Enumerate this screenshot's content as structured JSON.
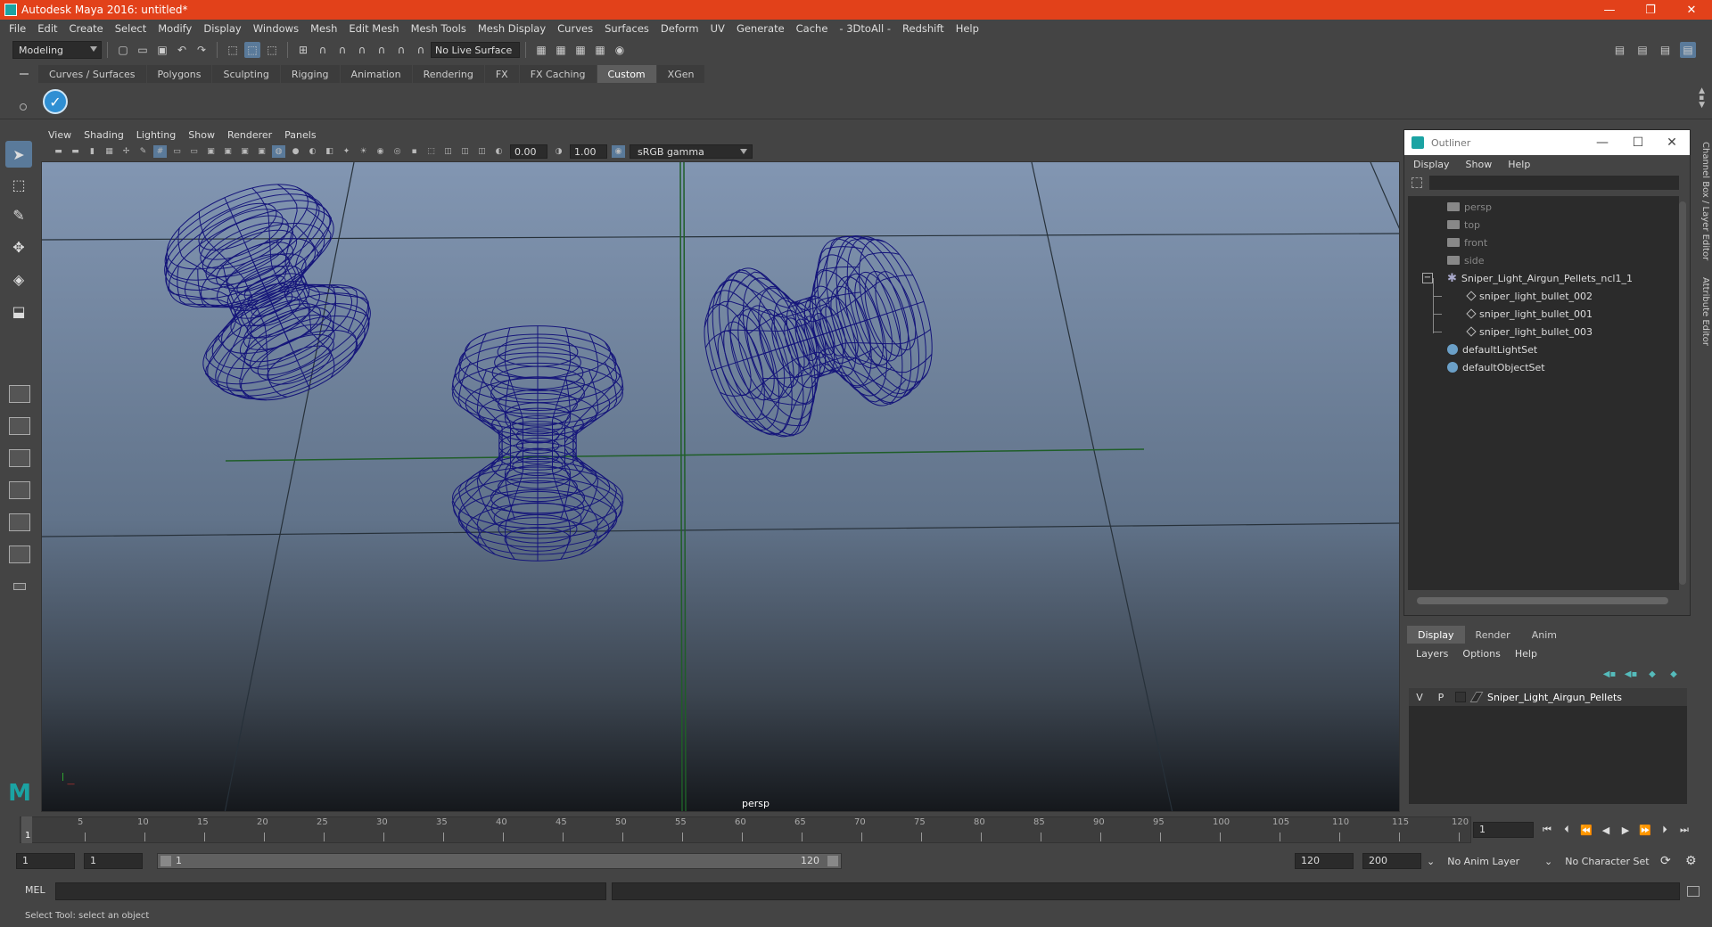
{
  "window": {
    "title": "Autodesk Maya 2016: untitled*"
  },
  "menubar": [
    "File",
    "Edit",
    "Create",
    "Select",
    "Modify",
    "Display",
    "Windows",
    "Mesh",
    "Edit Mesh",
    "Mesh Tools",
    "Mesh Display",
    "Curves",
    "Surfaces",
    "Deform",
    "UV",
    "Generate",
    "Cache",
    "- 3DtoAll -",
    "Redshift",
    "Help"
  ],
  "statusline": {
    "mode": "Modeling",
    "live_surface": "No Live Surface"
  },
  "shelf": {
    "tabs": [
      "Curves / Surfaces",
      "Polygons",
      "Sculpting",
      "Rigging",
      "Animation",
      "Rendering",
      "FX",
      "FX Caching",
      "Custom",
      "XGen"
    ],
    "active_tab": "Custom"
  },
  "viewport": {
    "menu": [
      "View",
      "Shading",
      "Lighting",
      "Show",
      "Renderer",
      "Panels"
    ],
    "exposure": "0.00",
    "gamma": "1.00",
    "color_space": "sRGB gamma",
    "camera_label": "persp",
    "wire_color": "#15157a"
  },
  "outliner": {
    "title": "Outliner",
    "menu": [
      "Display",
      "Show",
      "Help"
    ],
    "items": [
      {
        "label": "persp",
        "type": "camera",
        "dim": true
      },
      {
        "label": "top",
        "type": "camera",
        "dim": true
      },
      {
        "label": "front",
        "type": "camera",
        "dim": true
      },
      {
        "label": "side",
        "type": "camera",
        "dim": true
      },
      {
        "label": "Sniper_Light_Airgun_Pellets_ncl1_1",
        "type": "group",
        "dim": false
      },
      {
        "label": "sniper_light_bullet_002",
        "type": "mesh",
        "dim": false
      },
      {
        "label": "sniper_light_bullet_001",
        "type": "mesh",
        "dim": false
      },
      {
        "label": "sniper_light_bullet_003",
        "type": "mesh",
        "dim": false
      },
      {
        "label": "defaultLightSet",
        "type": "set",
        "dim": false
      },
      {
        "label": "defaultObjectSet",
        "type": "set",
        "dim": false
      }
    ]
  },
  "edge_tabs": [
    "Channel Box / Layer Editor",
    "Attribute Editor"
  ],
  "layer_editor": {
    "tabs": [
      "Display",
      "Render",
      "Anim"
    ],
    "active_tab": "Display",
    "menu": [
      "Layers",
      "Options",
      "Help"
    ],
    "layer": {
      "v": "V",
      "p": "P",
      "name": "Sniper_Light_Airgun_Pellets"
    }
  },
  "timeline": {
    "ticks": [
      "5",
      "10",
      "15",
      "20",
      "25",
      "30",
      "35",
      "40",
      "45",
      "50",
      "55",
      "60",
      "65",
      "70",
      "75",
      "80",
      "85",
      "90",
      "95",
      "100",
      "105",
      "110",
      "115",
      "120"
    ],
    "current_frame": "1",
    "frame_field": "1"
  },
  "range": {
    "start": "1",
    "playback_start": "1",
    "slider_start": "1",
    "slider_end": "120",
    "playback_end": "120",
    "end": "200",
    "anim_layer": "No Anim Layer",
    "character_set": "No Character Set"
  },
  "cmdline": {
    "label": "MEL"
  },
  "helpline": {
    "text": "Select Tool: select an object"
  }
}
